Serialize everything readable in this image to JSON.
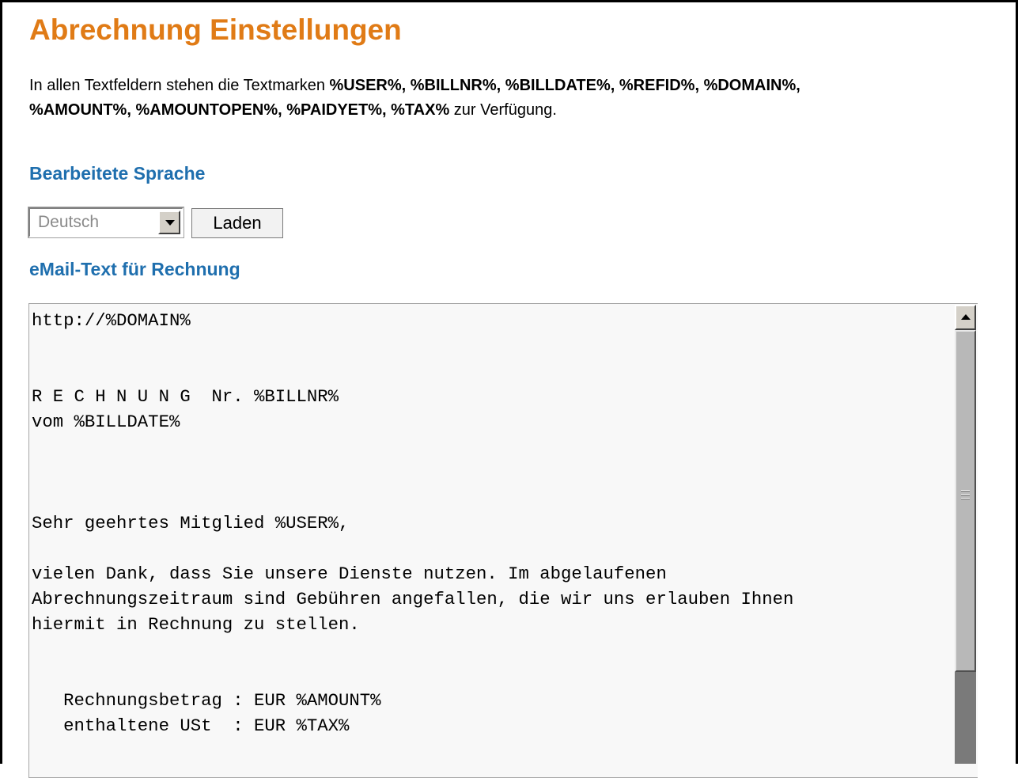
{
  "page": {
    "title": "Abrechnung Einstellungen",
    "intro": {
      "prefix": "In allen Textfeldern stehen die Textmarken ",
      "markers": [
        "%USER%",
        "%BILLNR%",
        "%BILLDATE%",
        "%REFID%",
        "%DOMAIN%",
        "%AMOUNT%",
        "%AMOUNTOPEN%",
        "%PAIDYET%",
        "%TAX%"
      ],
      "suffix": " zur Verfügung."
    }
  },
  "language_section": {
    "heading": "Bearbeitete Sprache",
    "select_value": "Deutsch",
    "load_button": "Laden"
  },
  "email_section": {
    "heading": "eMail-Text für Rechnung",
    "body": "http://%DOMAIN%\n\n\nR E C H N U N G  Nr. %BILLNR%\nvom %BILLDATE%\n\n\n\nSehr geehrtes Mitglied %USER%,\n\nvielen Dank, dass Sie unsere Dienste nutzen. Im abgelaufenen\nAbrechnungszeitraum sind Gebühren angefallen, die wir uns erlauben Ihnen\nhiermit in Rechnung zu stellen.\n\n\n   Rechnungsbetrag : EUR %AMOUNT%\n   enthaltene USt  : EUR %TAX%"
  },
  "colors": {
    "title": "#e07b16",
    "section_heading": "#1f6fae"
  },
  "icons": {
    "dropdown": "chevron-down-icon",
    "scroll_up": "arrow-up-icon"
  }
}
